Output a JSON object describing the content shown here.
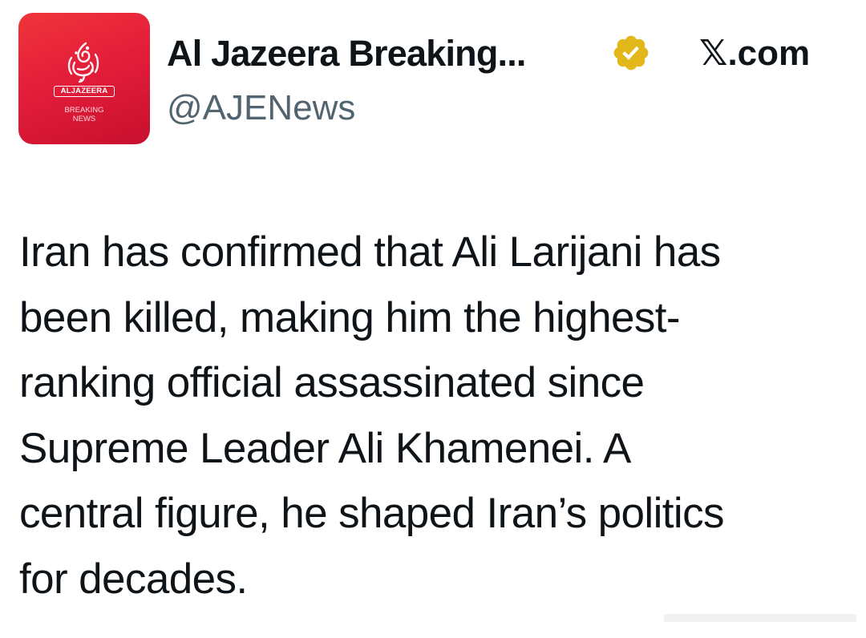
{
  "post": {
    "display_name": "Al Jazeera Breaking...",
    "handle": "@AJENews",
    "source_prefix": "𝕏",
    "source_suffix": ".com",
    "verified_badge_color": "#e2b719",
    "text_lines": [
      "Iran has confirmed that Ali Larijani has",
      "been killed, making him the highest-",
      "ranking official assassinated since",
      "Supreme Leader Ali Khamenei. A",
      "central figure, he shaped Iran’s politics",
      "for decades."
    ]
  },
  "avatar": {
    "wordmark": "ALJAZEERA",
    "sub_line1": "BREAKING",
    "sub_line2": "NEWS",
    "background_color": "#e41e3a"
  },
  "icons": {
    "avatar": "al-jazeera-logo-icon",
    "verified": "verified-badge-icon"
  }
}
